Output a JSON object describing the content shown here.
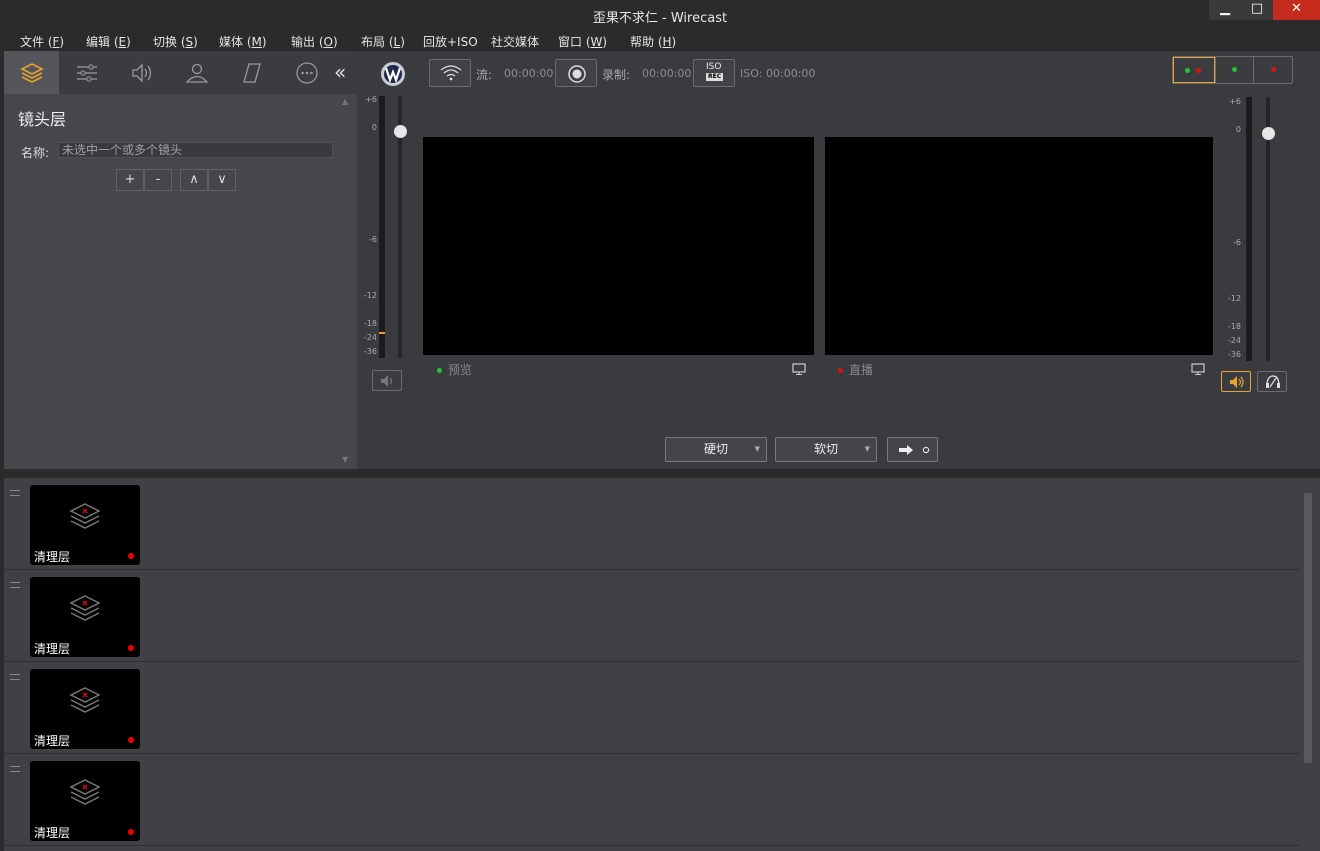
{
  "window": {
    "title": "歪果不求仁 - Wirecast",
    "min_label": "▁",
    "max_label": "□",
    "close_label": "✕"
  },
  "menu": [
    {
      "label": "文件 (",
      "key": "F",
      "suffix": ")"
    },
    {
      "label": "编辑 (",
      "key": "E",
      "suffix": ")"
    },
    {
      "label": "切换 (",
      "key": "S",
      "suffix": ")"
    },
    {
      "label": "媒体 (",
      "key": "M",
      "suffix": ")"
    },
    {
      "label": "输出 (",
      "key": "O",
      "suffix": ")"
    },
    {
      "label": "布局 (",
      "key": "L",
      "suffix": ")"
    },
    {
      "label": "回放+ISO",
      "key": "",
      "suffix": ""
    },
    {
      "label": "社交媒体",
      "key": "",
      "suffix": ""
    },
    {
      "label": "窗口 (",
      "key": "W",
      "suffix": ")"
    },
    {
      "label": "帮助 (",
      "key": "H",
      "suffix": ")"
    }
  ],
  "left_panel": {
    "tabs": [
      "layers-icon",
      "sliders-icon",
      "audio-icon",
      "person-icon",
      "parallelogram-icon",
      "more-icon"
    ],
    "collapse": "«",
    "heading": "镜头层",
    "name_label": "名称:",
    "name_placeholder": "未选中一个或多个镜头",
    "add": "+",
    "remove": "-",
    "up": "∧",
    "down": "∨"
  },
  "toolbar": {
    "stream_label": "流:",
    "stream_time": "00:00:00",
    "record_label": "录制:",
    "record_time": "00:00:00",
    "iso_label": "ISO:",
    "iso_time": "00:00:00",
    "iso_text": "ISO",
    "iso_rec": "REC"
  },
  "meter_ticks_left": [
    "+6",
    "0",
    "-6",
    "-12",
    "-18",
    "-24",
    "-36"
  ],
  "meter_ticks_right": [
    "+6",
    "0",
    "-6",
    "-12",
    "-18",
    "-24",
    "-36"
  ],
  "preview": {
    "label": "预览",
    "dot_color": "#27c23a"
  },
  "live": {
    "label": "直播",
    "dot_color": "#e01010"
  },
  "transitions": {
    "hard_cut": "硬切",
    "soft_cut": "软切"
  },
  "status_colors": {
    "green": "#27c23a",
    "red": "#e01010",
    "accent": "#e8a22d"
  },
  "shots": [
    {
      "label": "清理层"
    },
    {
      "label": "清理层"
    },
    {
      "label": "清理层"
    },
    {
      "label": "清理层"
    }
  ]
}
